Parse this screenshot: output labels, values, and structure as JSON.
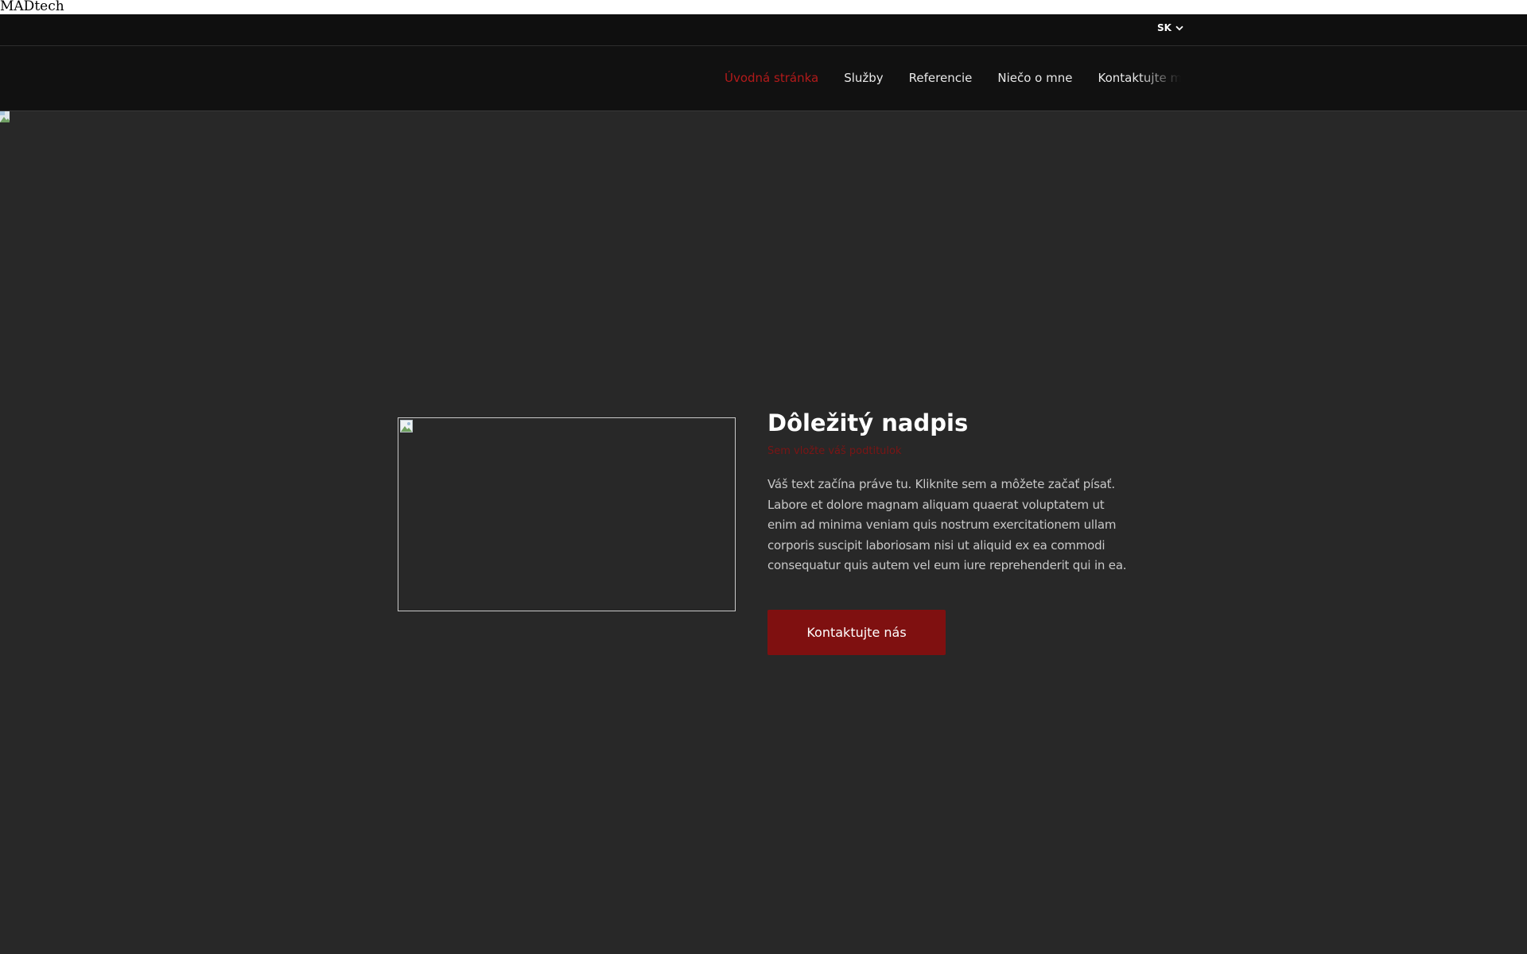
{
  "site": {
    "title": "MADtech"
  },
  "top_bar": {
    "language": "SK"
  },
  "nav": {
    "items": [
      {
        "label": "Úvodná stránka",
        "active": true
      },
      {
        "label": "Služby",
        "active": false
      },
      {
        "label": "Referencie",
        "active": false
      },
      {
        "label": "Niečo o mne",
        "active": false
      },
      {
        "label": "Kontaktujte ma",
        "active": false
      }
    ]
  },
  "hero": {
    "heading": "Dôležitý nadpis",
    "subtitle": "Sem vložte váš podtitulok",
    "body": "Váš text začína práve tu. Kliknite sem a môžete začať písať. Labore et dolore magnam aliquam quaerat voluptatem ut enim ad minima veniam quis nostrum exercitationem ullam corporis suscipit laboriosam nisi ut aliquid ex ea commodi consequatur quis autem vel eum iure reprehenderit qui in ea.",
    "cta_label": "Kontaktujte nás"
  },
  "colors": {
    "accent": "#7f1010",
    "active_nav": "#b21a1a",
    "header_bg": "#0f0f0f",
    "hero_bg": "#282828"
  },
  "icons": {
    "language_dropdown": "chevron-down-icon",
    "broken_image": "broken-image-icon"
  }
}
